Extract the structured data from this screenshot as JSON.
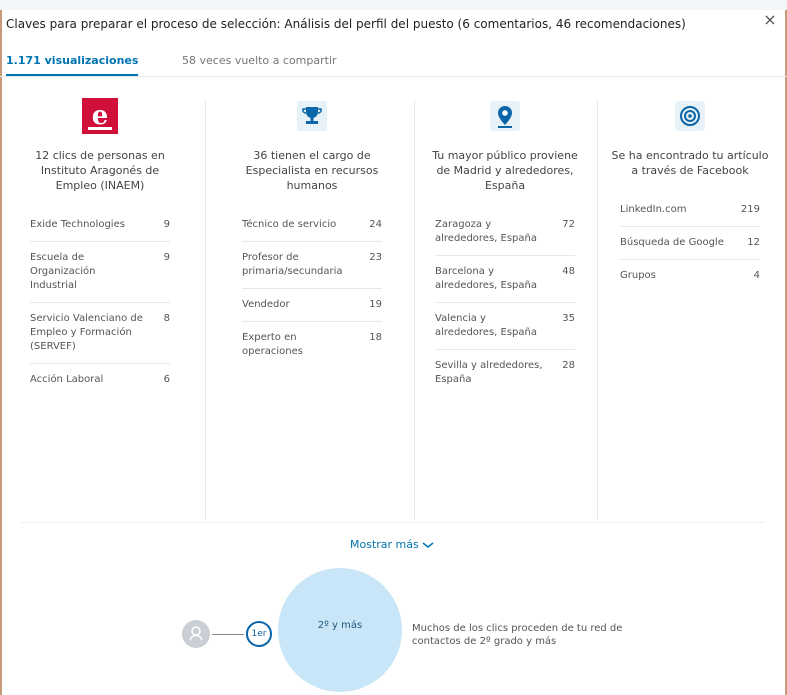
{
  "header": {
    "title": "Claves para preparar el proceso de selección: Análisis del perfil del puesto   (6 comentarios, 46 recomendaciones)",
    "close_label": "×"
  },
  "tabs": [
    {
      "label": "1.171 visualizaciones",
      "active": true
    },
    {
      "label": "58 veces vuelto a compartir",
      "active": false
    }
  ],
  "columns": [
    {
      "icon": "inaem-logo-icon",
      "title": "12 clics de personas en Instituto Aragonés de Empleo (INAEM)",
      "items": [
        {
          "name": "Exide Technologies",
          "count": "9"
        },
        {
          "name": "Escuela de Organización Industrial",
          "count": "9"
        },
        {
          "name": "Servicio Valenciano de Empleo y Formación (SERVEF)",
          "count": "8"
        },
        {
          "name": "Acción Laboral",
          "count": "6"
        }
      ]
    },
    {
      "icon": "trophy-icon",
      "title": "36 tienen el cargo de Especialista en recursos humanos",
      "items": [
        {
          "name": "Técnico de servicio",
          "count": "24"
        },
        {
          "name": "Profesor de primaria/secundaria",
          "count": "23"
        },
        {
          "name": "Vendedor",
          "count": "19"
        },
        {
          "name": "Experto en operaciones",
          "count": "18"
        }
      ]
    },
    {
      "icon": "location-pin-icon",
      "title": "Tu mayor público proviene de Madrid y alrededores, España",
      "items": [
        {
          "name": "Zaragoza y alrededores, España",
          "count": "72"
        },
        {
          "name": "Barcelona y alrededores, España",
          "count": "48"
        },
        {
          "name": "Valencia y alrededores, España",
          "count": "35"
        },
        {
          "name": "Sevilla y alrededores, España",
          "count": "28"
        }
      ]
    },
    {
      "icon": "target-icon",
      "title": "Se ha encontrado tu artículo a través de Facebook",
      "items": [
        {
          "name": "LinkedIn.com",
          "count": "219"
        },
        {
          "name": "Búsqueda de Google",
          "count": "12"
        },
        {
          "name": "Grupos",
          "count": "4"
        }
      ]
    }
  ],
  "show_more": {
    "label": "Mostrar más"
  },
  "network": {
    "first_label": "1er",
    "second_label": "2º y más",
    "description": "Muchos de los clics proceden de tu red de contactos de 2º grado y más"
  },
  "colors": {
    "accent": "#0073b1",
    "inaem_red": "#d0103a",
    "icon_blue": "#0a66a8",
    "bubble": "#c8e6f7"
  }
}
